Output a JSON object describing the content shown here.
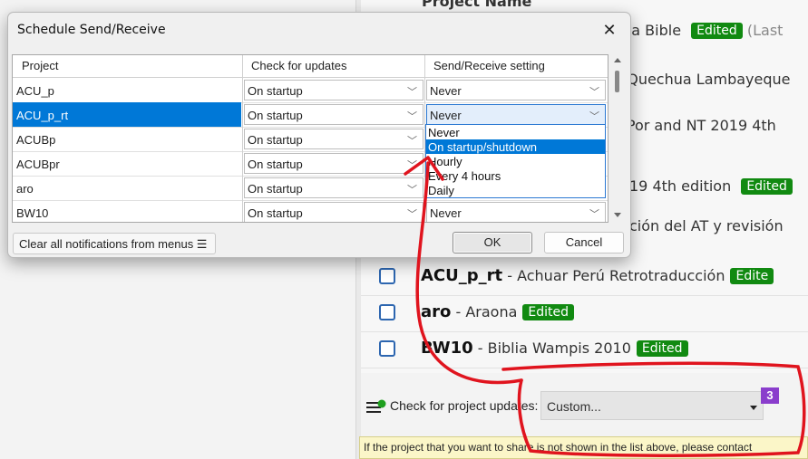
{
  "background_panel": {
    "header_label": "Project Name",
    "top_row": {
      "text": "hua Bible",
      "badge": "Edited",
      "suffix": "(Last"
    },
    "fragments": [
      "n Quechua Lambayeque",
      "T Por and NT 2019 4th",
      "19 4th edition",
      "ción del AT y revisión"
    ],
    "fragment_badge": "Edited",
    "projects": [
      {
        "code": "ACU_p_rt",
        "name": "- Achuar Perú Retrotraducción",
        "badge": "Edite"
      },
      {
        "code": "aro",
        "name": "- Araona",
        "badge": "Edited"
      },
      {
        "code": "BW10",
        "name": "- Biblia Wampis 2010",
        "badge": "Edited"
      }
    ],
    "update_label": "Check for project updates:",
    "update_value": "Custom...",
    "step_badge": "3",
    "info_message": "If the project that you want to share is not shown in the list above, please contact"
  },
  "dialog": {
    "title": "Schedule Send/Receive",
    "close_symbol": "✕",
    "columns": [
      "Project",
      "Check for updates",
      "Send/Receive setting"
    ],
    "rows": [
      {
        "project": "ACU_p",
        "check": "On startup",
        "send": "Never"
      },
      {
        "project": "ACU_p_rt",
        "check": "On startup",
        "send": "Never"
      },
      {
        "project": "ACUBp",
        "check": "On startup",
        "send": ""
      },
      {
        "project": "ACUBpr",
        "check": "On startup",
        "send": ""
      },
      {
        "project": "aro",
        "check": "On startup",
        "send": ""
      },
      {
        "project": "BW10",
        "check": "On startup",
        "send": "Never"
      }
    ],
    "selected_row": "ACU_p_rt",
    "dropdown_options": [
      "Never",
      "On startup/shutdown",
      "Hourly",
      "Every 4 hours",
      "Daily"
    ],
    "highlighted_option": "On startup/shutdown",
    "clear_button": "Clear all notifications from menus ☰",
    "ok_button": "OK",
    "cancel_button": "Cancel"
  },
  "colors": {
    "selection": "#0078d7",
    "edited_badge": "#118a11",
    "annotation": "#e0141e",
    "step_badge": "#8a3dcc"
  }
}
